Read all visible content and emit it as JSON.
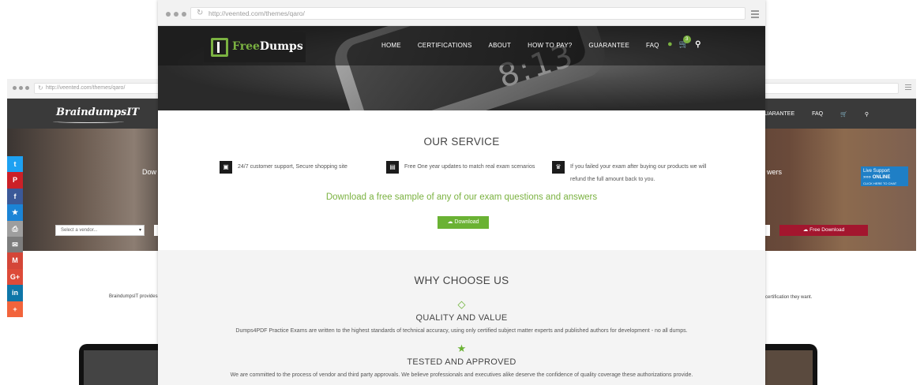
{
  "back_browser": {
    "url": "http://veented.com/themes/qaro/",
    "logo": "BraindumpsIT",
    "nav": [
      "GUARANTEE",
      "FAQ"
    ],
    "cart_count": "0",
    "hero_left_fragment": "Dow",
    "hero_right_fragment": "wers",
    "vendor_placeholder": "Select a vendor...",
    "free_download_label": "Free Download",
    "live_support": {
      "line1": "Live Support",
      "line2": "ONLINE",
      "line3": "CLICK HERE TO CHAT"
    },
    "text_left": "BraindumpsIT provides",
    "text_right": "certification they want."
  },
  "share_bar": {
    "items": [
      {
        "icon": "twitter-icon",
        "glyph": "t",
        "color": "#1da1f2"
      },
      {
        "icon": "pinterest-icon",
        "glyph": "P",
        "color": "#cb2027"
      },
      {
        "icon": "facebook-icon",
        "glyph": "f",
        "color": "#3b5998"
      },
      {
        "icon": "favorite-icon",
        "glyph": "★",
        "color": "#1b84d6"
      },
      {
        "icon": "print-icon",
        "glyph": "⎙",
        "color": "#9e9e9e"
      },
      {
        "icon": "email-icon",
        "glyph": "✉",
        "color": "#7d7d7d"
      },
      {
        "icon": "gmail-icon",
        "glyph": "M",
        "color": "#d44638"
      },
      {
        "icon": "google-plus-icon",
        "glyph": "G+",
        "color": "#dd4b39"
      },
      {
        "icon": "linkedin-icon",
        "glyph": "in",
        "color": "#0e76a8"
      },
      {
        "icon": "more-icon",
        "glyph": "+",
        "color": "#f2643c"
      }
    ]
  },
  "front_browser": {
    "url": "http://veented.com/themes/qaro/",
    "logo": {
      "part1": "Free",
      "part2": "Dumps"
    },
    "hero_clock": "8:13",
    "nav": [
      "HOME",
      "CERTIFICATIONS",
      "ABOUT",
      "HOW TO PAY?",
      "GUARANTEE",
      "FAQ"
    ],
    "cart_count": "3",
    "service": {
      "title": "OUR SERVICE",
      "features": [
        {
          "icon": "calendar-icon",
          "text": "24/7 customer support, Secure shopping site"
        },
        {
          "icon": "book-icon",
          "text": "Free One year updates to match real exam scenarios"
        },
        {
          "icon": "trophy-icon",
          "text": "If you failed your exam after buying our products we will refund the full amount back to you."
        }
      ],
      "tagline": "Download a free sample of any of our exam questions and answers",
      "download_label": "Download"
    },
    "why": {
      "title": "WHY CHOOSE US",
      "items": [
        {
          "icon": "diamond-icon",
          "title": "QUALITY AND VALUE",
          "text": "Dumps4PDF Practice Exams are written to the highest standards of technical accuracy, using only certified subject matter experts and published authors for development - no all dumps."
        },
        {
          "icon": "star-icon",
          "title": "TESTED AND APPROVED",
          "text": "We are committed to the process of vendor and third party approvals. We believe professionals and executives alike deserve the confidence of quality coverage these authorizations provide."
        }
      ]
    }
  }
}
